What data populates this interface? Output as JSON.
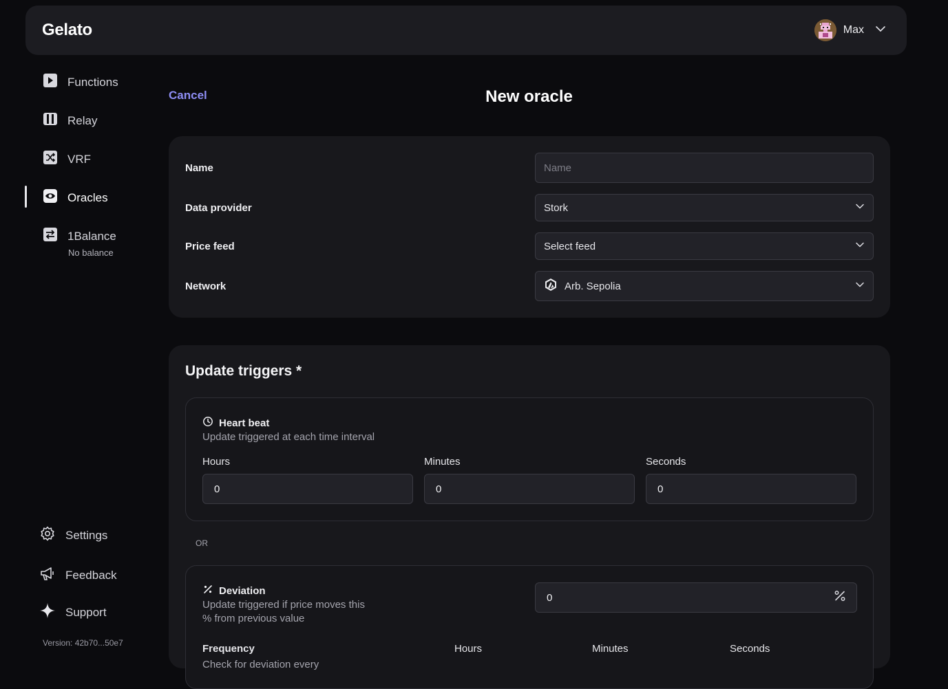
{
  "header": {
    "logo": "Gelato",
    "user_name": "Max"
  },
  "sidebar": {
    "items": [
      {
        "label": "Functions",
        "icon": "play-square-icon"
      },
      {
        "label": "Relay",
        "icon": "relay-icon"
      },
      {
        "label": "VRF",
        "icon": "shuffle-icon"
      },
      {
        "label": "Oracles",
        "icon": "eye-icon",
        "active": true
      },
      {
        "label": "1Balance",
        "icon": "transfer-icon",
        "sub": "No balance"
      }
    ],
    "bottom": [
      {
        "label": "Settings",
        "icon": "gear-icon"
      },
      {
        "label": "Feedback",
        "icon": "megaphone-icon"
      },
      {
        "label": "Support",
        "icon": "sparkle-icon"
      }
    ],
    "version": "Version: 42b70...50e7"
  },
  "page": {
    "cancel_label": "Cancel",
    "title": "New oracle"
  },
  "form": {
    "name_label": "Name",
    "name_placeholder": "Name",
    "provider_label": "Data provider",
    "provider_value": "Stork",
    "feed_label": "Price feed",
    "feed_value": "Select feed",
    "network_label": "Network",
    "network_value": "Arb. Sepolia"
  },
  "triggers": {
    "title": "Update triggers *",
    "heartbeat": {
      "title": "Heart beat",
      "desc": "Update triggered at each time interval",
      "hours_label": "Hours",
      "hours": "0",
      "minutes_label": "Minutes",
      "minutes": "0",
      "seconds_label": "Seconds",
      "seconds": "0"
    },
    "or_label": "OR",
    "deviation": {
      "title": "Deviation",
      "desc_line1": "Update triggered if price moves this",
      "desc_line2": "% from previous value",
      "value": "0",
      "frequency_label": "Frequency",
      "frequency_desc": "Check for deviation every",
      "hours_label": "Hours",
      "minutes_label": "Minutes",
      "seconds_label": "Seconds"
    }
  }
}
